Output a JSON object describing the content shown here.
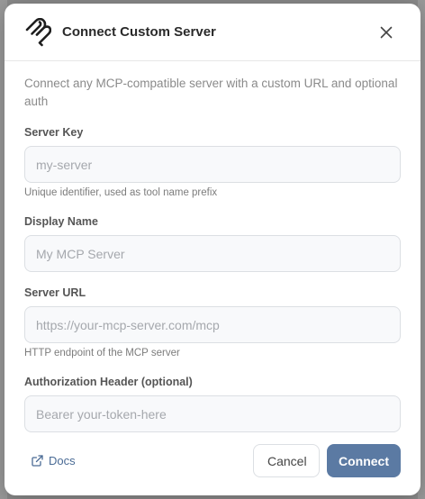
{
  "dialog": {
    "title": "Connect Custom Server",
    "description": "Connect any MCP-compatible server with a custom URL and optional auth",
    "close_icon": "close-icon",
    "logo_icon": "mcp-logo-icon"
  },
  "fields": {
    "server_key": {
      "label": "Server Key",
      "placeholder": "my-server",
      "value": "",
      "hint": "Unique identifier, used as tool name prefix"
    },
    "display_name": {
      "label": "Display Name",
      "placeholder": "My MCP Server",
      "value": ""
    },
    "server_url": {
      "label": "Server URL",
      "placeholder": "https://your-mcp-server.com/mcp",
      "value": "",
      "hint": "HTTP endpoint of the MCP server"
    },
    "auth_header": {
      "label": "Authorization Header (optional)",
      "placeholder": "Bearer your-token-here",
      "value": ""
    }
  },
  "footer": {
    "docs_label": "Docs",
    "docs_icon": "external-link-icon",
    "cancel_label": "Cancel",
    "connect_label": "Connect"
  },
  "colors": {
    "accent": "#5b7aa3",
    "link": "#4a6b95",
    "title": "#2a2a2a"
  }
}
